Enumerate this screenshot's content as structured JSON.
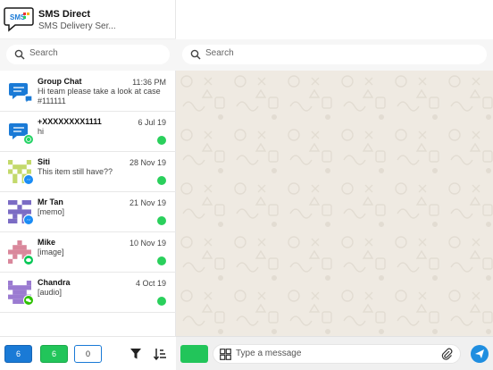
{
  "app": {
    "title": "SMS Direct",
    "subtitle": "SMS Delivery Ser...",
    "logo_text": "SMS"
  },
  "search": {
    "placeholder": "Search"
  },
  "chat_search": {
    "placeholder": "Search"
  },
  "chats": [
    {
      "name": "Group Chat",
      "time": "11:36 PM",
      "preview": "Hi team please take a look at case #111111",
      "channel": "sms-chat-icon",
      "unread_dot": false,
      "avatar": "chat-bubble",
      "avatar_color": "#1a7ad6"
    },
    {
      "name": "+XXXXXXXX1111",
      "time": "6 Jul 19",
      "preview": "hi",
      "channel": "whatsapp-icon",
      "unread_dot": true,
      "avatar": "chat-bubble",
      "avatar_color": "#1a7ad6"
    },
    {
      "name": "Siti",
      "time": "28 Nov 19",
      "preview": "This item still have??",
      "channel": "messenger-icon",
      "unread_dot": true,
      "avatar": "identicon",
      "avatar_color": "#c3d96b"
    },
    {
      "name": "Mr Tan",
      "time": "21 Nov 19",
      "preview": "[memo]",
      "channel": "messenger-icon",
      "unread_dot": true,
      "avatar": "identicon",
      "avatar_color": "#7b6cc4"
    },
    {
      "name": "Mike",
      "time": "10 Nov 19",
      "preview": "[image]",
      "channel": "line-icon",
      "unread_dot": true,
      "avatar": "identicon",
      "avatar_color": "#d9879b"
    },
    {
      "name": "Chandra",
      "time": "4 Oct 19",
      "preview": "[audio]",
      "channel": "wechat-icon",
      "unread_dot": true,
      "avatar": "identicon",
      "avatar_color": "#9b7bd1"
    }
  ],
  "footer": {
    "count_blue": "6",
    "count_green": "6",
    "count_outline": "0"
  },
  "composer": {
    "placeholder": "Type a message"
  },
  "colors": {
    "primary_blue": "#1a7ad6",
    "green": "#22c55a",
    "chat_background": "#efeae2"
  }
}
